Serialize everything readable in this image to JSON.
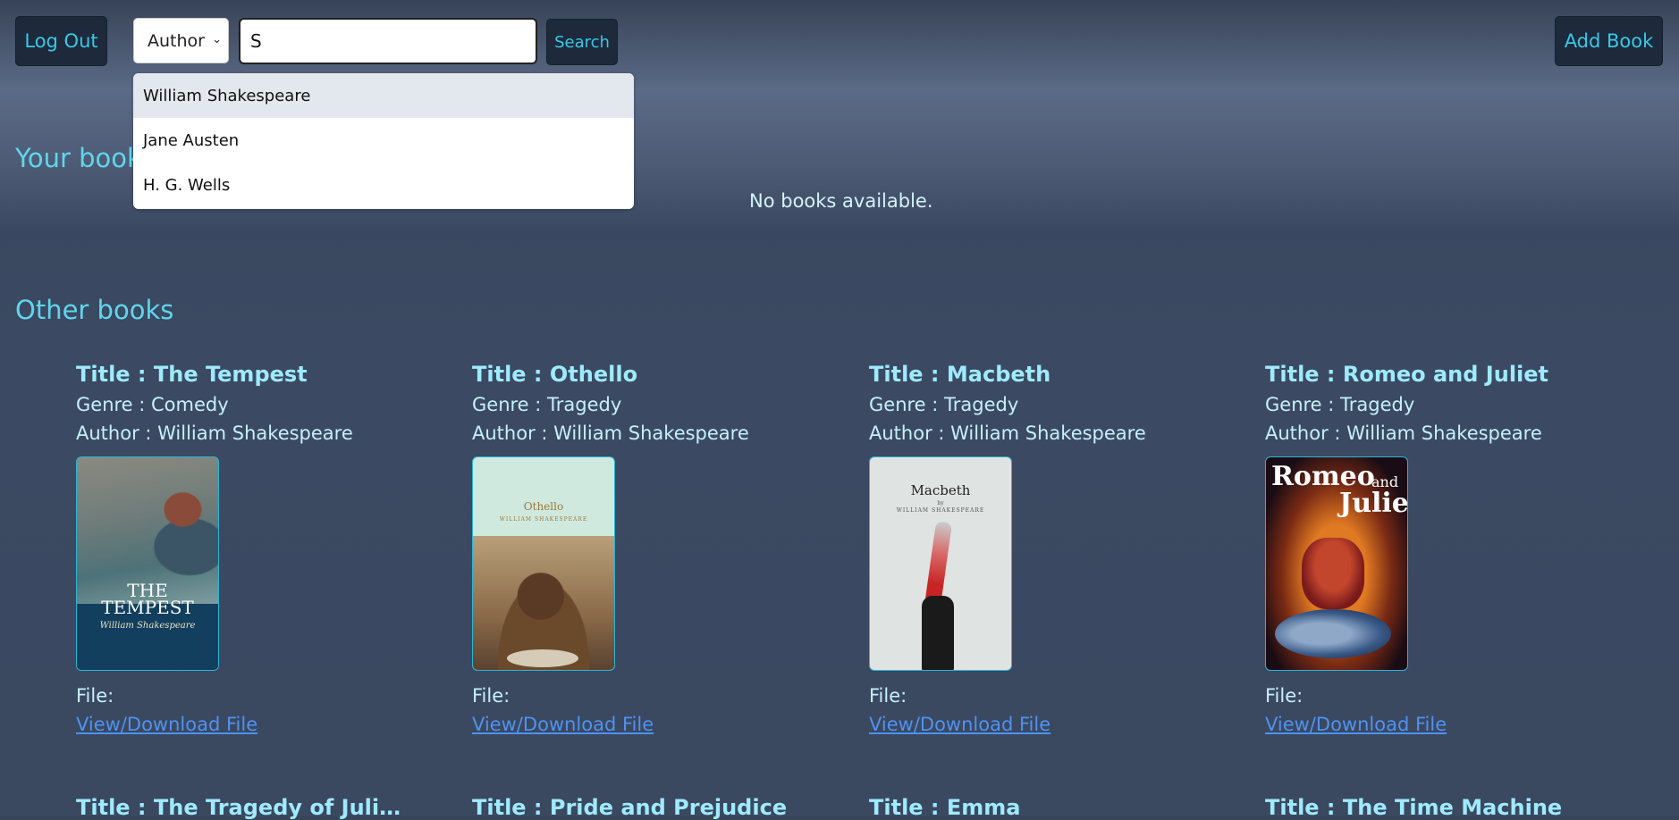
{
  "header": {
    "logout_label": "Log Out",
    "filter_value": "Author",
    "search_value": "S",
    "search_label": "Search",
    "add_book_label": "Add Book"
  },
  "dropdown": {
    "items": [
      "William Shakespeare",
      "Jane Austen",
      "H. G. Wells"
    ]
  },
  "your_books": {
    "title": "Your books",
    "empty_text": "No books available."
  },
  "other_books": {
    "title": "Other books",
    "books": [
      {
        "title": "Title : The Tempest",
        "genre": "Genre : Comedy",
        "author": "Author : William Shakespeare",
        "file_label": "File:",
        "link": "View/Download File"
      },
      {
        "title": "Title : Othello",
        "genre": "Genre : Tragedy",
        "author": "Author : William Shakespeare",
        "file_label": "File:",
        "link": "View/Download File"
      },
      {
        "title": "Title : Macbeth",
        "genre": "Genre : Tragedy",
        "author": "Author : William Shakespeare",
        "file_label": "File:",
        "link": "View/Download File"
      },
      {
        "title": "Title : Romeo and Juliet",
        "genre": "Genre : Tragedy",
        "author": "Author : William Shakespeare",
        "file_label": "File:",
        "link": "View/Download File"
      }
    ],
    "next_row_titles": [
      "Title : The Tragedy of Julius Ca...",
      "Title : Pride and Prejudice",
      "Title : Emma",
      "Title : The Time Machine"
    ]
  },
  "covers": {
    "tempest": {
      "line1": "THE",
      "line2": "TEMPEST",
      "line3": "William Shakespeare"
    },
    "othello": {
      "line1": "Othello",
      "line2": "WILLIAM SHAKESPEARE"
    },
    "macbeth": {
      "line1": "Macbeth",
      "line2": "by",
      "line3": "WILLIAM SHAKESPEARE"
    },
    "romeo": {
      "line1": "Romeo",
      "line2": "and",
      "line3": "Juliet"
    }
  }
}
